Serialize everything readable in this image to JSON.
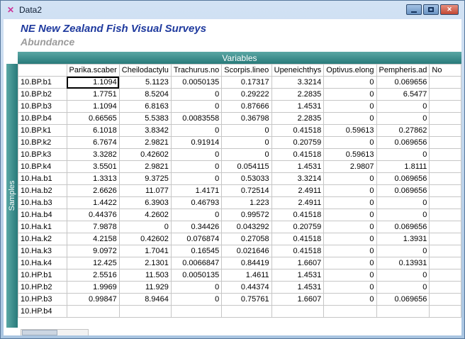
{
  "window": {
    "title": "Data2"
  },
  "icons": {
    "close": "✕",
    "window_icon_glyph": "✕"
  },
  "header": {
    "title": "NE New Zealand Fish Visual Surveys",
    "subtitle": "Abundance"
  },
  "grid": {
    "variables_label": "Variables",
    "samples_label": "Samples",
    "columns": [
      "Parika.scaber",
      "Cheilodactylu",
      "Trachurus.no",
      "Scorpis.lineo",
      "Upeneichthys",
      "Optivus.elong",
      "Pempheris.ad",
      "No"
    ],
    "selection": {
      "row": 0,
      "col": 0
    },
    "rows": [
      {
        "label": "10.BP.b1",
        "values": [
          "1.1094",
          "5.1123",
          "0.0050135",
          "0.17317",
          "3.3214",
          "0",
          "0.069656"
        ]
      },
      {
        "label": "10.BP.b2",
        "values": [
          "1.7751",
          "8.5204",
          "0",
          "0.29222",
          "2.2835",
          "0",
          "6.5477"
        ]
      },
      {
        "label": "10.BP.b3",
        "values": [
          "1.1094",
          "6.8163",
          "0",
          "0.87666",
          "1.4531",
          "0",
          "0"
        ]
      },
      {
        "label": "10.BP.b4",
        "values": [
          "0.66565",
          "5.5383",
          "0.0083558",
          "0.36798",
          "2.2835",
          "0",
          "0"
        ]
      },
      {
        "label": "10.BP.k1",
        "values": [
          "6.1018",
          "3.8342",
          "0",
          "0",
          "0.41518",
          "0.59613",
          "0.27862"
        ]
      },
      {
        "label": "10.BP.k2",
        "values": [
          "6.7674",
          "2.9821",
          "0.91914",
          "0",
          "0.20759",
          "0",
          "0.069656"
        ]
      },
      {
        "label": "10.BP.k3",
        "values": [
          "3.3282",
          "0.42602",
          "0",
          "0",
          "0.41518",
          "0.59613",
          "0"
        ]
      },
      {
        "label": "10.BP.k4",
        "values": [
          "3.5501",
          "2.9821",
          "0",
          "0.054115",
          "1.4531",
          "2.9807",
          "1.8111"
        ]
      },
      {
        "label": "10.Ha.b1",
        "values": [
          "1.3313",
          "9.3725",
          "0",
          "0.53033",
          "3.3214",
          "0",
          "0.069656"
        ]
      },
      {
        "label": "10.Ha.b2",
        "values": [
          "2.6626",
          "11.077",
          "1.4171",
          "0.72514",
          "2.4911",
          "0",
          "0.069656"
        ]
      },
      {
        "label": "10.Ha.b3",
        "values": [
          "1.4422",
          "6.3903",
          "0.46793",
          "1.223",
          "2.4911",
          "0",
          "0"
        ]
      },
      {
        "label": "10.Ha.b4",
        "values": [
          "0.44376",
          "4.2602",
          "0",
          "0.99572",
          "0.41518",
          "0",
          "0"
        ]
      },
      {
        "label": "10.Ha.k1",
        "values": [
          "7.9878",
          "0",
          "0.34426",
          "0.043292",
          "0.20759",
          "0",
          "0.069656"
        ]
      },
      {
        "label": "10.Ha.k2",
        "values": [
          "4.2158",
          "0.42602",
          "0.076874",
          "0.27058",
          "0.41518",
          "0",
          "1.3931"
        ]
      },
      {
        "label": "10.Ha.k3",
        "values": [
          "9.0972",
          "1.7041",
          "0.16545",
          "0.021646",
          "0.41518",
          "0",
          "0"
        ]
      },
      {
        "label": "10.Ha.k4",
        "values": [
          "12.425",
          "2.1301",
          "0.0066847",
          "0.84419",
          "1.6607",
          "0",
          "0.13931"
        ]
      },
      {
        "label": "10.HP.b1",
        "values": [
          "2.5516",
          "11.503",
          "0.0050135",
          "1.4611",
          "1.4531",
          "0",
          "0"
        ]
      },
      {
        "label": "10.HP.b2",
        "values": [
          "1.9969",
          "11.929",
          "0",
          "0.44374",
          "1.4531",
          "0",
          "0"
        ]
      },
      {
        "label": "10.HP.b3",
        "values": [
          "0.99847",
          "8.9464",
          "0",
          "0.75761",
          "1.6607",
          "0",
          "0.069656"
        ]
      },
      {
        "label": "10.HP.b4",
        "values": [
          "",
          "",
          "",
          "",
          "",
          "",
          ""
        ]
      }
    ]
  }
}
